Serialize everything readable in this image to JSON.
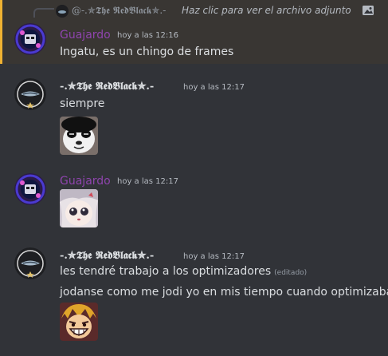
{
  "reply": {
    "author": "@-.✯𝕿𝖍𝖊 𝕽𝖊𝖉𝕭𝖑𝖆𝖈𝖐✯.-",
    "text": "Haz clic para ver el archivo adjunto",
    "icon": "image-icon"
  },
  "messages": [
    {
      "author": "Guajardo",
      "author_color": "#8e44ad",
      "timestamp": "hoy a las 12:16",
      "lines": [
        "Ingatu, es un chingo de frames"
      ]
    },
    {
      "author": "-.✯𝕿𝖍𝖊 𝕽𝖊𝖉𝕭𝖑𝖆𝖈𝖐✯.-",
      "timestamp": "hoy a las 12:17",
      "lines": [
        "siempre"
      ],
      "emoji": "panda-face-emoji"
    },
    {
      "author": "Guajardo",
      "author_color": "#8e44ad",
      "timestamp": "hoy a las 12:17",
      "emoji": "anime-girl-emoji"
    },
    {
      "author": "-.✯𝕿𝖍𝖊 𝕽𝖊𝖉𝕭𝖑𝖆𝖈𝖐✯.-",
      "timestamp": "hoy a las 12:17",
      "lines": [
        "les tendré trabajo a los optimizadores",
        "jodanse como me jodi yo en mis tiempo cuando optimizaba"
      ],
      "edited": "(editado)",
      "emoji": "laughing-face-emoji"
    }
  ],
  "colors": {
    "background": "#313338",
    "highlight": "#393633",
    "highlight_border": "#f0b232"
  }
}
